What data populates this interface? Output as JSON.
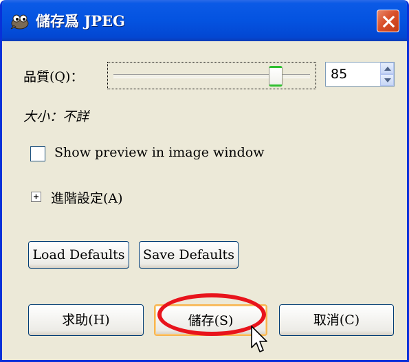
{
  "window": {
    "title": "儲存爲 JPEG"
  },
  "quality": {
    "label": "品質(Q)：",
    "value": 85,
    "min": 0,
    "max": 100
  },
  "size": {
    "label": "大小：不詳"
  },
  "preview": {
    "label": "Show preview in image window",
    "checked": false
  },
  "advanced": {
    "label": "進階設定(A)",
    "expanded": false
  },
  "defaults": {
    "load_label": "Load Defaults",
    "save_label": "Save Defaults"
  },
  "actions": {
    "help_label": "求助(H)",
    "save_label": "儲存(S)",
    "cancel_label": "取消(C)"
  },
  "colors": {
    "titlebar": "#0453e0",
    "window_bg": "#ece9d8",
    "close": "#d9512b",
    "highlight": "#e8141c",
    "thumb_accent": "#2fbf2f"
  },
  "icons": {
    "app": "gimp-icon",
    "close": "close-icon",
    "expand": "plus-icon"
  }
}
